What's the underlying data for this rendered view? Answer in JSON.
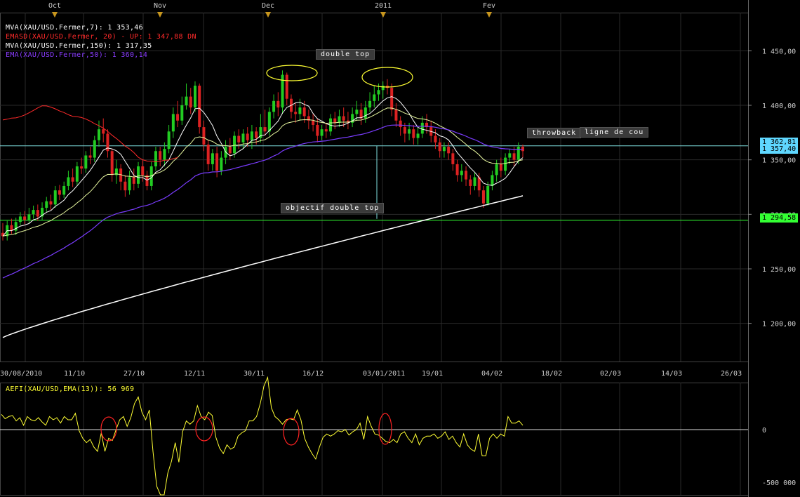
{
  "chart_data": {
    "type": "candlestick",
    "instrument": "XAU/USD",
    "top_axis_months": [
      "Oct",
      "Nov",
      "Dec",
      "2011",
      "Fev"
    ],
    "x_tick_labels": [
      "30/08/2010",
      "11/10",
      "27/10",
      "12/11",
      "30/11",
      "16/12",
      "03/01/2011",
      "19/01",
      "04/02",
      "18/02",
      "02/03",
      "14/03",
      "26/03"
    ],
    "y_tick_labels": [
      "1 450,00",
      "1 400,00",
      "1 350,00",
      "1 300,00",
      "1 250,00",
      "1 200,00"
    ],
    "y_ticks": [
      1450,
      1400,
      1350,
      1300,
      1250,
      1200
    ],
    "ylim": [
      1165,
      1485
    ],
    "indicator_labels": [
      {
        "text": "MVA(XAU/USD.Fermer,7): 1 353,46",
        "color": "#ffffff"
      },
      {
        "text": "EMASD(XAU/USD.Fermer, 20) - UP: 1 347,88  DN",
        "color": "#ff2a2a"
      },
      {
        "text": "MVA(XAU/USD.Fermer,150): 1 317,35",
        "color": "#ffffff"
      },
      {
        "text": "EMA(XAU/USD.Fermer,50): 1 360,14",
        "color": "#8a3cff"
      }
    ],
    "price_tags": [
      {
        "text": "1 362,81",
        "bg": "#5fd7ff",
        "price": 1362.81
      },
      {
        "text": "1 357,40",
        "bg": "#5fd7ff",
        "price": 1357.4
      },
      {
        "text": "1 294,58",
        "bg": "#33ff33",
        "price": 1294.58
      }
    ],
    "horizontal_lines": [
      {
        "price": 1362.81,
        "color": "#7fe0e0"
      },
      {
        "price": 1294.58,
        "color": "#33ff33"
      }
    ],
    "annotations": [
      "double top",
      "throwback",
      "ligne de cou",
      "objectif double top"
    ],
    "candles": [
      [
        1283,
        1280,
        1292,
        1276
      ],
      [
        1280,
        1290,
        1294,
        1276
      ],
      [
        1290,
        1285,
        1296,
        1282
      ],
      [
        1285,
        1293,
        1297,
        1281
      ],
      [
        1293,
        1298,
        1302,
        1290
      ],
      [
        1298,
        1295,
        1303,
        1291
      ],
      [
        1295,
        1300,
        1306,
        1292
      ],
      [
        1300,
        1304,
        1308,
        1296
      ],
      [
        1304,
        1298,
        1309,
        1294
      ],
      [
        1298,
        1306,
        1311,
        1295
      ],
      [
        1306,
        1312,
        1316,
        1302
      ],
      [
        1312,
        1309,
        1318,
        1304
      ],
      [
        1309,
        1322,
        1326,
        1306
      ],
      [
        1322,
        1318,
        1327,
        1313
      ],
      [
        1318,
        1326,
        1330,
        1315
      ],
      [
        1326,
        1334,
        1340,
        1322
      ],
      [
        1334,
        1330,
        1342,
        1325
      ],
      [
        1330,
        1344,
        1348,
        1327
      ],
      [
        1344,
        1342,
        1352,
        1337
      ],
      [
        1342,
        1354,
        1358,
        1338
      ],
      [
        1354,
        1352,
        1362,
        1346
      ],
      [
        1352,
        1368,
        1372,
        1348
      ],
      [
        1368,
        1378,
        1386,
        1362
      ],
      [
        1378,
        1374,
        1388,
        1366
      ],
      [
        1374,
        1358,
        1378,
        1352
      ],
      [
        1358,
        1336,
        1360,
        1330
      ],
      [
        1336,
        1342,
        1350,
        1328
      ],
      [
        1342,
        1330,
        1346,
        1322
      ],
      [
        1330,
        1322,
        1336,
        1316
      ],
      [
        1322,
        1334,
        1340,
        1318
      ],
      [
        1334,
        1328,
        1342,
        1322
      ],
      [
        1328,
        1344,
        1348,
        1324
      ],
      [
        1344,
        1336,
        1350,
        1330
      ],
      [
        1336,
        1326,
        1340,
        1322
      ],
      [
        1326,
        1344,
        1348,
        1322
      ],
      [
        1344,
        1358,
        1362,
        1340
      ],
      [
        1358,
        1350,
        1362,
        1344
      ],
      [
        1350,
        1360,
        1366,
        1344
      ],
      [
        1360,
        1376,
        1382,
        1356
      ],
      [
        1376,
        1392,
        1398,
        1370
      ],
      [
        1392,
        1386,
        1404,
        1380
      ],
      [
        1386,
        1400,
        1408,
        1382
      ],
      [
        1400,
        1408,
        1420,
        1396
      ],
      [
        1408,
        1398,
        1416,
        1392
      ],
      [
        1398,
        1418,
        1422,
        1394
      ],
      [
        1418,
        1380,
        1420,
        1374
      ],
      [
        1380,
        1364,
        1386,
        1358
      ],
      [
        1364,
        1346,
        1368,
        1340
      ],
      [
        1346,
        1356,
        1360,
        1340
      ],
      [
        1356,
        1340,
        1362,
        1334
      ],
      [
        1340,
        1352,
        1358,
        1336
      ],
      [
        1352,
        1362,
        1368,
        1346
      ],
      [
        1362,
        1356,
        1370,
        1350
      ],
      [
        1356,
        1372,
        1376,
        1352
      ],
      [
        1372,
        1366,
        1378,
        1360
      ],
      [
        1366,
        1374,
        1378,
        1360
      ],
      [
        1374,
        1368,
        1380,
        1362
      ],
      [
        1368,
        1376,
        1382,
        1360
      ],
      [
        1376,
        1370,
        1380,
        1364
      ],
      [
        1370,
        1380,
        1392,
        1366
      ],
      [
        1380,
        1376,
        1396,
        1372
      ],
      [
        1376,
        1394,
        1398,
        1372
      ],
      [
        1394,
        1404,
        1410,
        1388
      ],
      [
        1404,
        1398,
        1412,
        1390
      ],
      [
        1398,
        1428,
        1432,
        1392
      ],
      [
        1428,
        1406,
        1430,
        1400
      ],
      [
        1406,
        1394,
        1410,
        1388
      ],
      [
        1394,
        1392,
        1402,
        1384
      ],
      [
        1392,
        1398,
        1406,
        1386
      ],
      [
        1398,
        1390,
        1404,
        1384
      ],
      [
        1390,
        1386,
        1396,
        1378
      ],
      [
        1386,
        1382,
        1392,
        1376
      ],
      [
        1382,
        1372,
        1388,
        1366
      ],
      [
        1372,
        1378,
        1382,
        1368
      ],
      [
        1378,
        1376,
        1384,
        1370
      ],
      [
        1376,
        1388,
        1392,
        1372
      ],
      [
        1388,
        1384,
        1394,
        1378
      ],
      [
        1384,
        1390,
        1396,
        1380
      ],
      [
        1390,
        1386,
        1398,
        1380
      ],
      [
        1386,
        1384,
        1394,
        1378
      ],
      [
        1384,
        1392,
        1398,
        1380
      ],
      [
        1392,
        1396,
        1404,
        1386
      ],
      [
        1396,
        1388,
        1402,
        1382
      ],
      [
        1388,
        1398,
        1404,
        1384
      ],
      [
        1398,
        1404,
        1412,
        1394
      ],
      [
        1404,
        1410,
        1418,
        1398
      ],
      [
        1410,
        1414,
        1420,
        1404
      ],
      [
        1414,
        1418,
        1422,
        1406
      ],
      [
        1418,
        1416,
        1424,
        1410
      ],
      [
        1416,
        1396,
        1420,
        1390
      ],
      [
        1396,
        1386,
        1402,
        1380
      ],
      [
        1386,
        1380,
        1390,
        1372
      ],
      [
        1380,
        1374,
        1384,
        1366
      ],
      [
        1374,
        1378,
        1384,
        1368
      ],
      [
        1378,
        1370,
        1382,
        1364
      ],
      [
        1370,
        1374,
        1380,
        1364
      ],
      [
        1374,
        1384,
        1390,
        1370
      ],
      [
        1384,
        1380,
        1392,
        1374
      ],
      [
        1380,
        1372,
        1386,
        1366
      ],
      [
        1372,
        1366,
        1378,
        1360
      ],
      [
        1366,
        1358,
        1370,
        1352
      ],
      [
        1358,
        1362,
        1366,
        1352
      ],
      [
        1362,
        1356,
        1366,
        1350
      ],
      [
        1356,
        1346,
        1360,
        1340
      ],
      [
        1346,
        1336,
        1350,
        1330
      ],
      [
        1336,
        1340,
        1346,
        1330
      ],
      [
        1340,
        1332,
        1344,
        1326
      ],
      [
        1332,
        1326,
        1336,
        1318
      ],
      [
        1326,
        1334,
        1338,
        1322
      ],
      [
        1334,
        1322,
        1338,
        1316
      ],
      [
        1322,
        1310,
        1326,
        1306
      ],
      [
        1310,
        1326,
        1330,
        1308
      ],
      [
        1326,
        1336,
        1340,
        1322
      ],
      [
        1336,
        1346,
        1350,
        1330
      ],
      [
        1346,
        1340,
        1352,
        1334
      ],
      [
        1340,
        1352,
        1356,
        1336
      ],
      [
        1352,
        1356,
        1360,
        1346
      ],
      [
        1356,
        1350,
        1362,
        1344
      ],
      [
        1350,
        1362,
        1366,
        1346
      ],
      [
        1362,
        1358,
        1364,
        1352
      ]
    ],
    "sub_panel": {
      "label": "AEFI(XAU/USD,EMA(13)): 56 969",
      "y_tick_labels": [
        "0",
        "-500 000"
      ],
      "oscillator": [
        70,
        50,
        60,
        65,
        40,
        55,
        20,
        60,
        45,
        40,
        55,
        35,
        20,
        60,
        45,
        55,
        30,
        60,
        45,
        45,
        75,
        -5,
        -40,
        -60,
        -45,
        -80,
        -100,
        -15,
        -100,
        -40,
        -50,
        0,
        45,
        60,
        15,
        55,
        120,
        150,
        80,
        45,
        90,
        -100,
        -260,
        -300,
        -300,
        -200,
        -145,
        -60,
        -150,
        -10,
        40,
        25,
        40,
        110,
        60,
        45,
        80,
        65,
        -35,
        -85,
        -110,
        -70,
        -90,
        -80,
        -30,
        -15,
        -5,
        40,
        40,
        60,
        120,
        200,
        240,
        100,
        60,
        45,
        25,
        45,
        50,
        45,
        90,
        45,
        -40,
        -80,
        -110,
        -135,
        -80,
        -35,
        -20,
        -30,
        -20,
        -5,
        -10,
        0,
        -25,
        -10,
        0,
        30,
        -45,
        60,
        15,
        -20,
        -25,
        -40,
        -55,
        -60,
        -45,
        -60,
        -20,
        -10,
        -40,
        -60,
        -20,
        -70,
        -40,
        -30,
        -30,
        -20,
        -40,
        -30,
        -10,
        -45,
        -30,
        -60,
        -80,
        -20,
        -70,
        -90,
        -100,
        -20,
        -120,
        -120,
        -40,
        -20,
        -40,
        -20,
        -30,
        60,
        30,
        30,
        40,
        20
      ]
    }
  }
}
